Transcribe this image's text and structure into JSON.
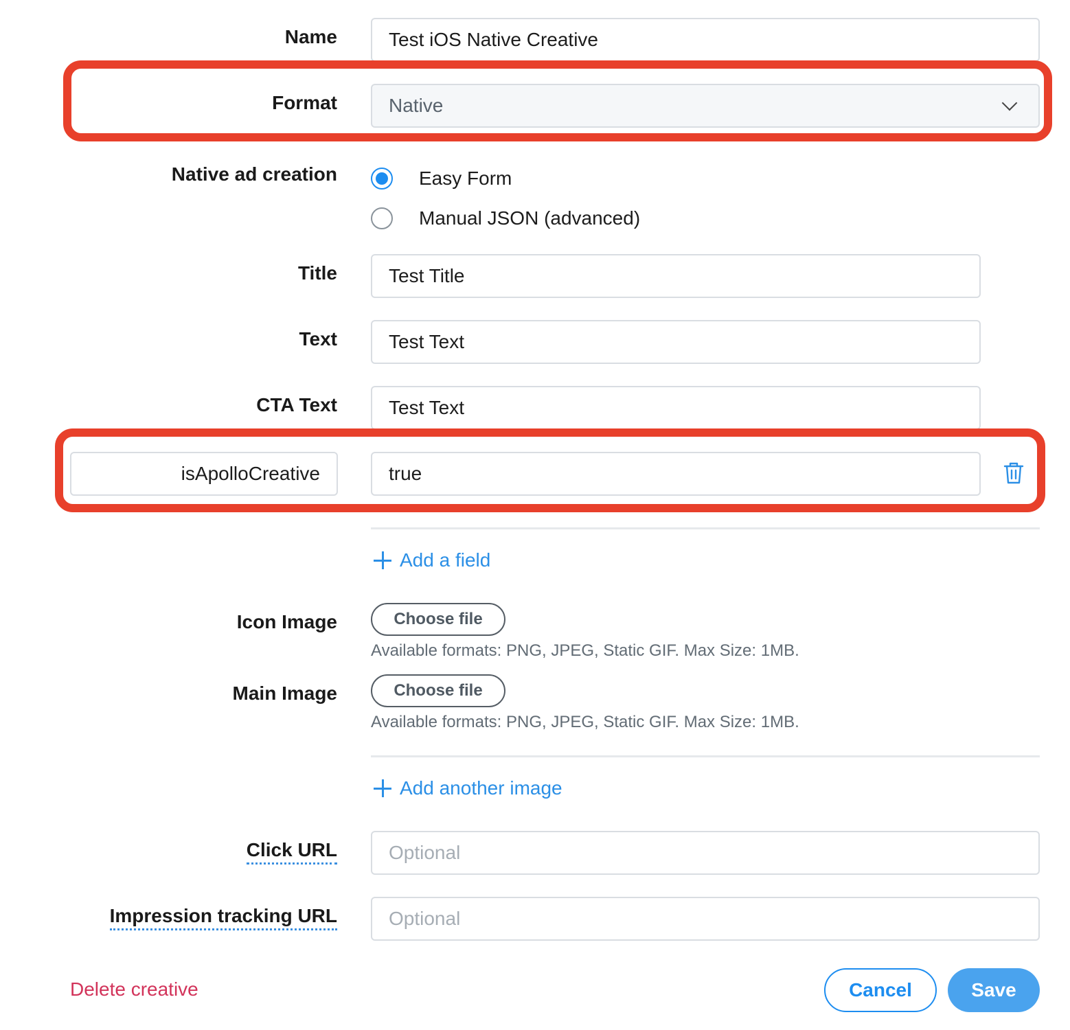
{
  "form": {
    "name": {
      "label": "Name",
      "value": "Test iOS Native Creative"
    },
    "format": {
      "label": "Format",
      "value": "Native"
    },
    "native_ad_creation": {
      "label": "Native ad creation",
      "options": [
        {
          "label": "Easy Form",
          "checked": true
        },
        {
          "label": "Manual JSON (advanced)",
          "checked": false
        }
      ]
    },
    "title": {
      "label": "Title",
      "value": "Test Title"
    },
    "text": {
      "label": "Text",
      "value": "Test Text"
    },
    "cta_text": {
      "label": "CTA Text",
      "value": "Test Text"
    },
    "custom_field": {
      "key": "isApolloCreative",
      "value": "true"
    },
    "add_field_label": "Add a field",
    "icon_image": {
      "label": "Icon Image",
      "button": "Choose file",
      "hint": "Available formats: PNG, JPEG, Static GIF. Max Size: 1MB."
    },
    "main_image": {
      "label": "Main Image",
      "button": "Choose file",
      "hint": "Available formats: PNG, JPEG, Static GIF. Max Size: 1MB."
    },
    "add_image_label": "Add another image",
    "click_url": {
      "label": "Click URL",
      "placeholder": "Optional"
    },
    "impression_url": {
      "label": "Impression tracking URL",
      "placeholder": "Optional"
    }
  },
  "footer": {
    "delete_label": "Delete creative",
    "cancel_label": "Cancel",
    "save_label": "Save"
  },
  "colors": {
    "highlight": "#e8402b",
    "accent": "#1d8df0",
    "link": "#2b8fe6",
    "danger": "#d2335a",
    "save_bg": "#4aa3ee"
  },
  "icons": [
    "chevron-down-icon",
    "plus-icon",
    "trash-icon"
  ]
}
